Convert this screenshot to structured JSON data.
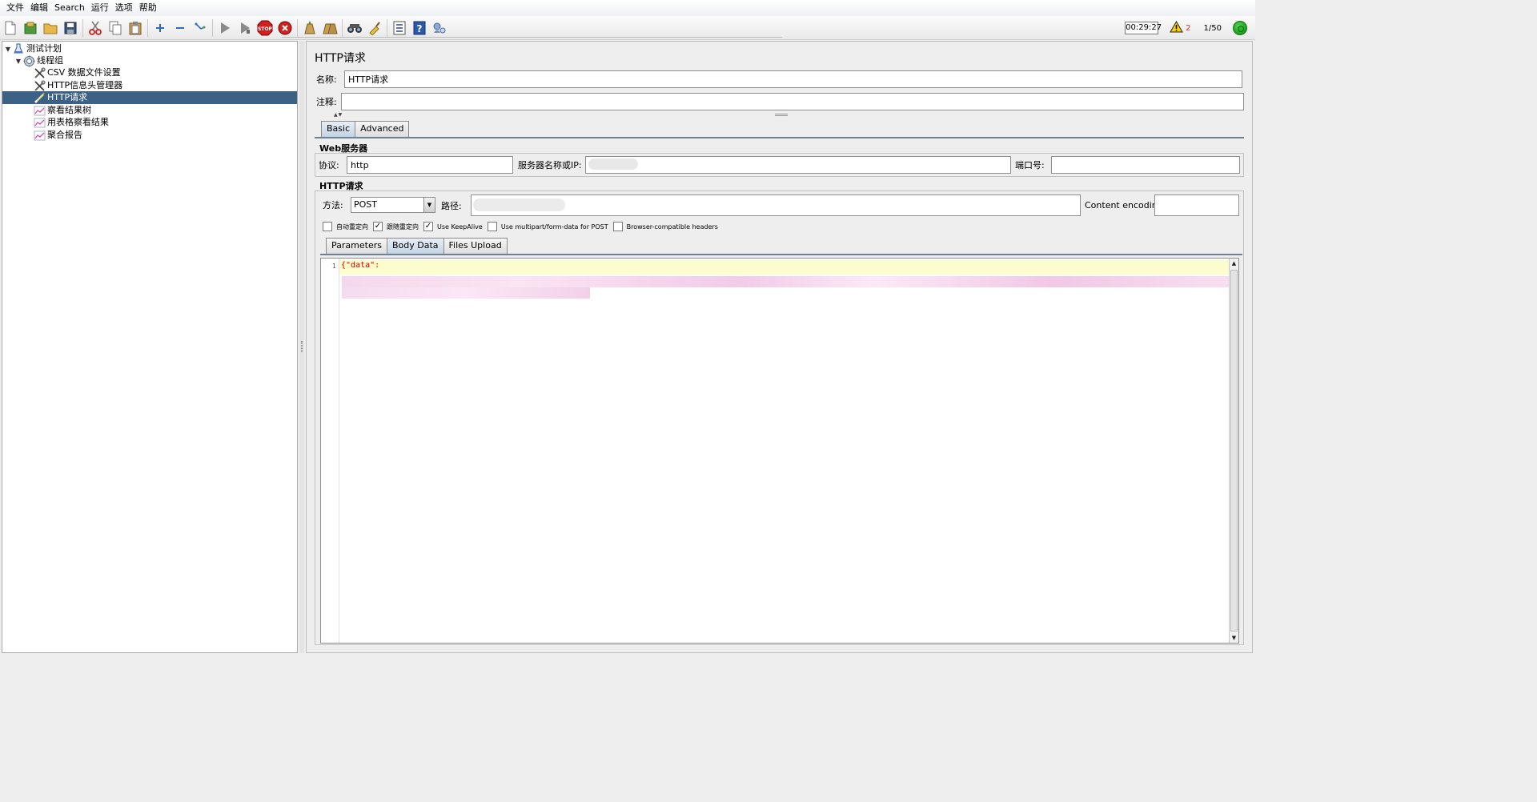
{
  "menu": [
    "文件",
    "编辑",
    "Search",
    "运行",
    "选项",
    "帮助"
  ],
  "toolbar": {
    "groups": [
      [
        "new-file-icon",
        "templates-icon",
        "open-folder-icon",
        "save-icon"
      ],
      [
        "cut-icon",
        "copy-icon",
        "paste-icon"
      ],
      [
        "expand-icon",
        "collapse-icon",
        "toggle-icon"
      ],
      [
        "start-icon",
        "start-no-pause-icon",
        "stop-icon",
        "shutdown-icon"
      ],
      [
        "clear-icon",
        "clear-all-icon"
      ],
      [
        "search-icon",
        "reset-search-icon"
      ],
      [
        "function-helper-icon",
        "help-icon",
        "remote-icon"
      ]
    ],
    "timer": "00:29:27",
    "warning_count": "2",
    "threads": "1/50"
  },
  "tree": [
    {
      "label": "测试计划",
      "icon": "test-plan-icon",
      "level": 0,
      "expanded": true
    },
    {
      "label": "线程组",
      "icon": "thread-group-icon",
      "level": 1,
      "expanded": true
    },
    {
      "label": "CSV 数据文件设置",
      "icon": "config-element-icon",
      "level": 2
    },
    {
      "label": "HTTP信息头管理器",
      "icon": "config-element-icon",
      "level": 2
    },
    {
      "label": "HTTP请求",
      "icon": "sampler-icon",
      "level": 2,
      "selected": true
    },
    {
      "label": "察看结果树",
      "icon": "listener-icon",
      "level": 2
    },
    {
      "label": "用表格察看结果",
      "icon": "listener-icon",
      "level": 2
    },
    {
      "label": "聚合报告",
      "icon": "listener-icon",
      "level": 2
    }
  ],
  "panel": {
    "title": "HTTP请求",
    "name_label": "名称:",
    "name_value": "HTTP请求",
    "comment_label": "注释:",
    "comment_value": "",
    "tabs": [
      "Basic",
      "Advanced"
    ],
    "active_tab": "Basic",
    "web_server": {
      "title": "Web服务器",
      "protocol_label": "协议:",
      "protocol_value": "http",
      "server_label": "服务器名称或IP:",
      "server_value": "",
      "port_label": "端口号:",
      "port_value": ""
    },
    "http_request": {
      "title": "HTTP请求",
      "method_label": "方法:",
      "method_value": "POST",
      "path_label": "路径:",
      "path_value": "",
      "encoding_label": "Content encoding:",
      "encoding_value": "",
      "checkboxes": [
        {
          "label": "自动重定向",
          "checked": false
        },
        {
          "label": "跟随重定向",
          "checked": true
        },
        {
          "label": "Use KeepAlive",
          "checked": true
        },
        {
          "label": "Use multipart/form-data for POST",
          "checked": false
        },
        {
          "label": "Browser-compatible headers",
          "checked": false
        }
      ],
      "body_tabs": [
        "Parameters",
        "Body Data",
        "Files Upload"
      ],
      "active_body_tab": "Body Data",
      "body": {
        "line_numbers": [
          "1"
        ],
        "first_line": "{\"data\":"
      }
    }
  },
  "colors": {
    "selection": "#3d6185",
    "editor_current_line": "#fdfccc",
    "body_text": "#cc0000",
    "warning_text": "#d62b2b"
  }
}
